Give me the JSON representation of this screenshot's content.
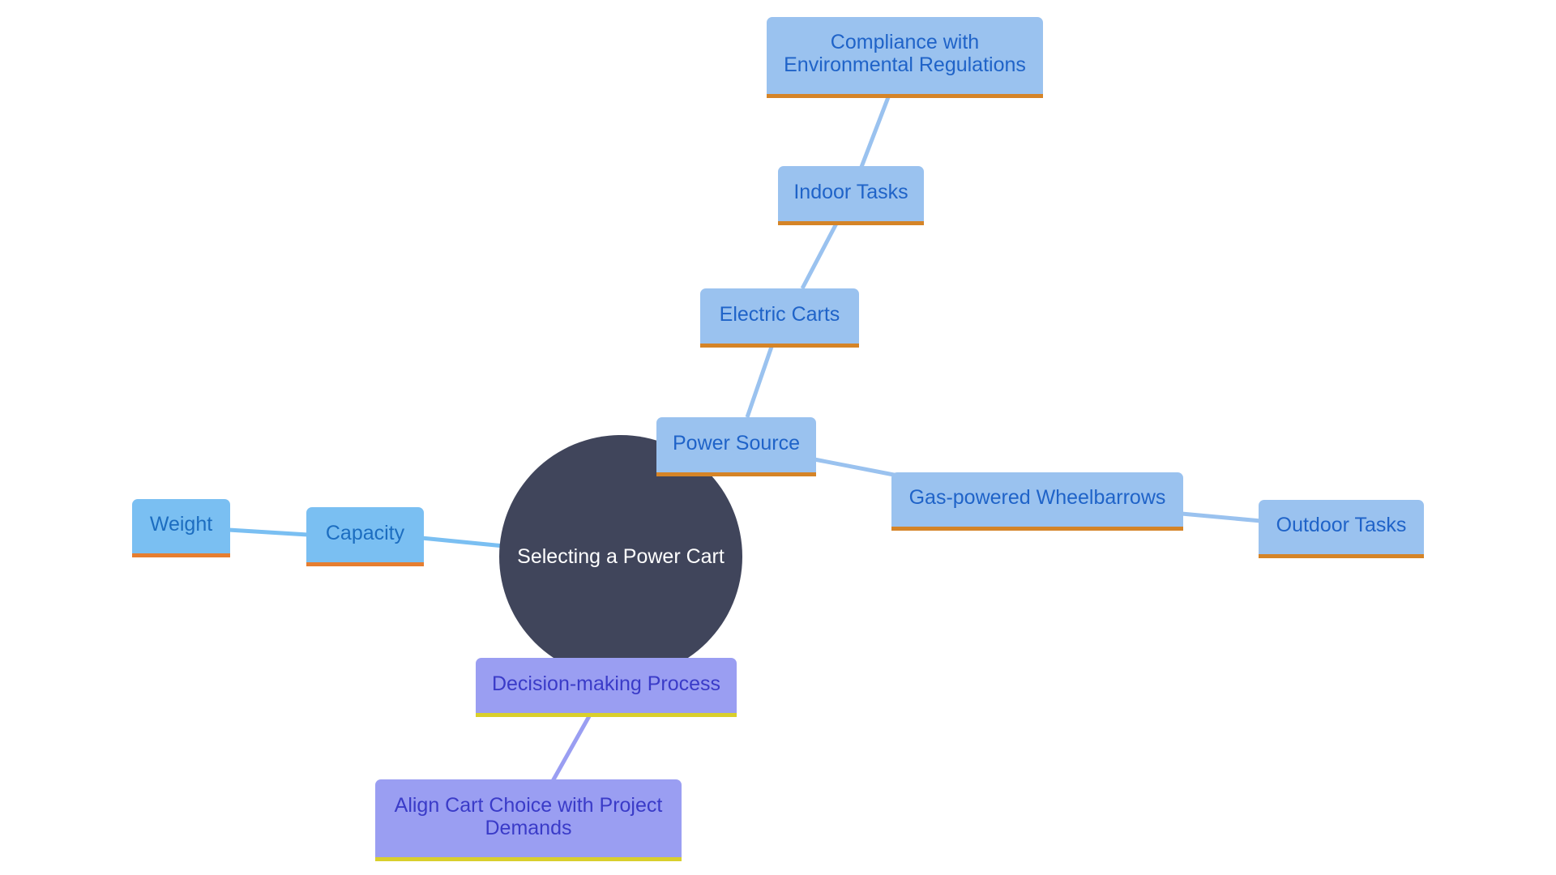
{
  "diagram": {
    "type": "mind-map",
    "root": {
      "label": "Selecting a Power Cart",
      "color": "#40455b"
    },
    "nodes": {
      "power_source": "Power Source",
      "electric_carts": "Electric Carts",
      "indoor_tasks": "Indoor Tasks",
      "compliance": "Compliance with Environmental Regulations",
      "gas_wheelbarrows": "Gas-powered Wheelbarrows",
      "outdoor_tasks": "Outdoor Tasks",
      "capacity": "Capacity",
      "weight": "Weight",
      "decision_process": "Decision-making Process",
      "align_choice": "Align Cart Choice with Project Demands"
    },
    "edges": [
      [
        "root",
        "power_source"
      ],
      [
        "power_source",
        "electric_carts"
      ],
      [
        "electric_carts",
        "indoor_tasks"
      ],
      [
        "indoor_tasks",
        "compliance"
      ],
      [
        "power_source",
        "gas_wheelbarrows"
      ],
      [
        "gas_wheelbarrows",
        "outdoor_tasks"
      ],
      [
        "root",
        "capacity"
      ],
      [
        "capacity",
        "weight"
      ],
      [
        "root",
        "decision_process"
      ],
      [
        "decision_process",
        "align_choice"
      ]
    ],
    "branch_colors": {
      "power_source": {
        "fill": "#9ac2ef",
        "text": "#1f63c8",
        "accent": "#d58427"
      },
      "capacity": {
        "fill": "#7abff2",
        "text": "#1c6dc0",
        "accent": "#e67e30"
      },
      "decision_process": {
        "fill": "#9a9ef2",
        "text": "#3a3bc8",
        "accent": "#d9cf2c"
      }
    }
  }
}
